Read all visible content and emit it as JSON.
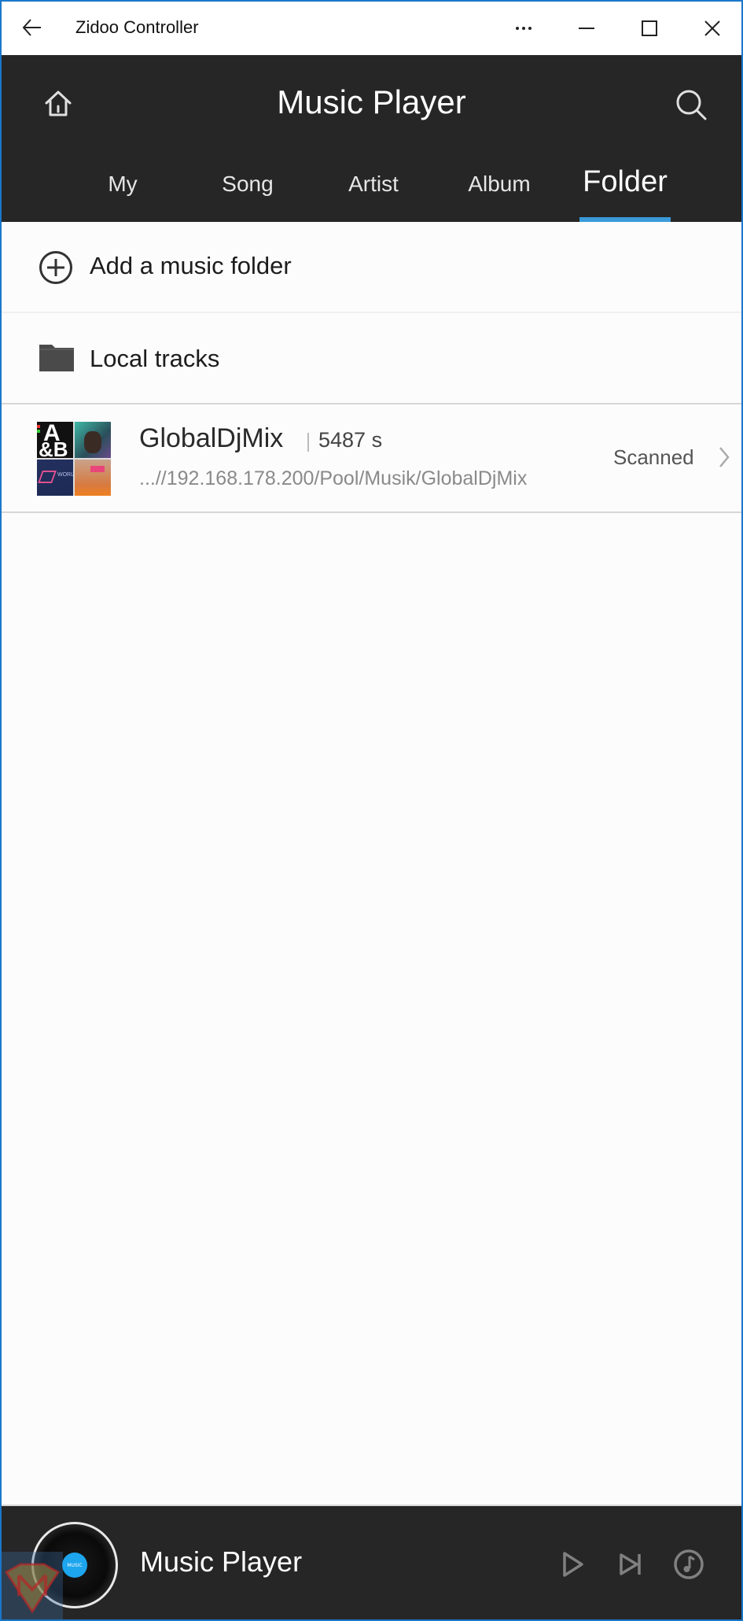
{
  "window": {
    "title": "Zidoo Controller",
    "controls": {
      "more": "more-icon",
      "minimize": "minimize-icon",
      "maximize": "maximize-icon",
      "close": "close-icon"
    },
    "border_color": "#1a77c9"
  },
  "header": {
    "title": "Music Player",
    "home_icon": "home-icon",
    "search_icon": "search-icon",
    "background": "#262626"
  },
  "tabs": [
    {
      "label": "My",
      "active": false
    },
    {
      "label": "Song",
      "active": false
    },
    {
      "label": "Artist",
      "active": false
    },
    {
      "label": "Album",
      "active": false
    },
    {
      "label": "Folder",
      "active": true
    }
  ],
  "accent_color": "#3a9ad9",
  "list": {
    "add_folder": {
      "label": "Add a music folder",
      "icon": "plus-circle-icon"
    },
    "local_tracks": {
      "label": "Local tracks",
      "icon": "folder-icon"
    },
    "folders": [
      {
        "name": "GlobalDjMix",
        "count": "5487 s",
        "path": "...//192.168.178.200/Pool/Musik/GlobalDjMix",
        "status": "Scanned"
      }
    ]
  },
  "player": {
    "title": "Music Player",
    "disc_label": "MUSIC",
    "controls": [
      "play-icon",
      "skip-next-icon",
      "music-note-icon"
    ]
  }
}
